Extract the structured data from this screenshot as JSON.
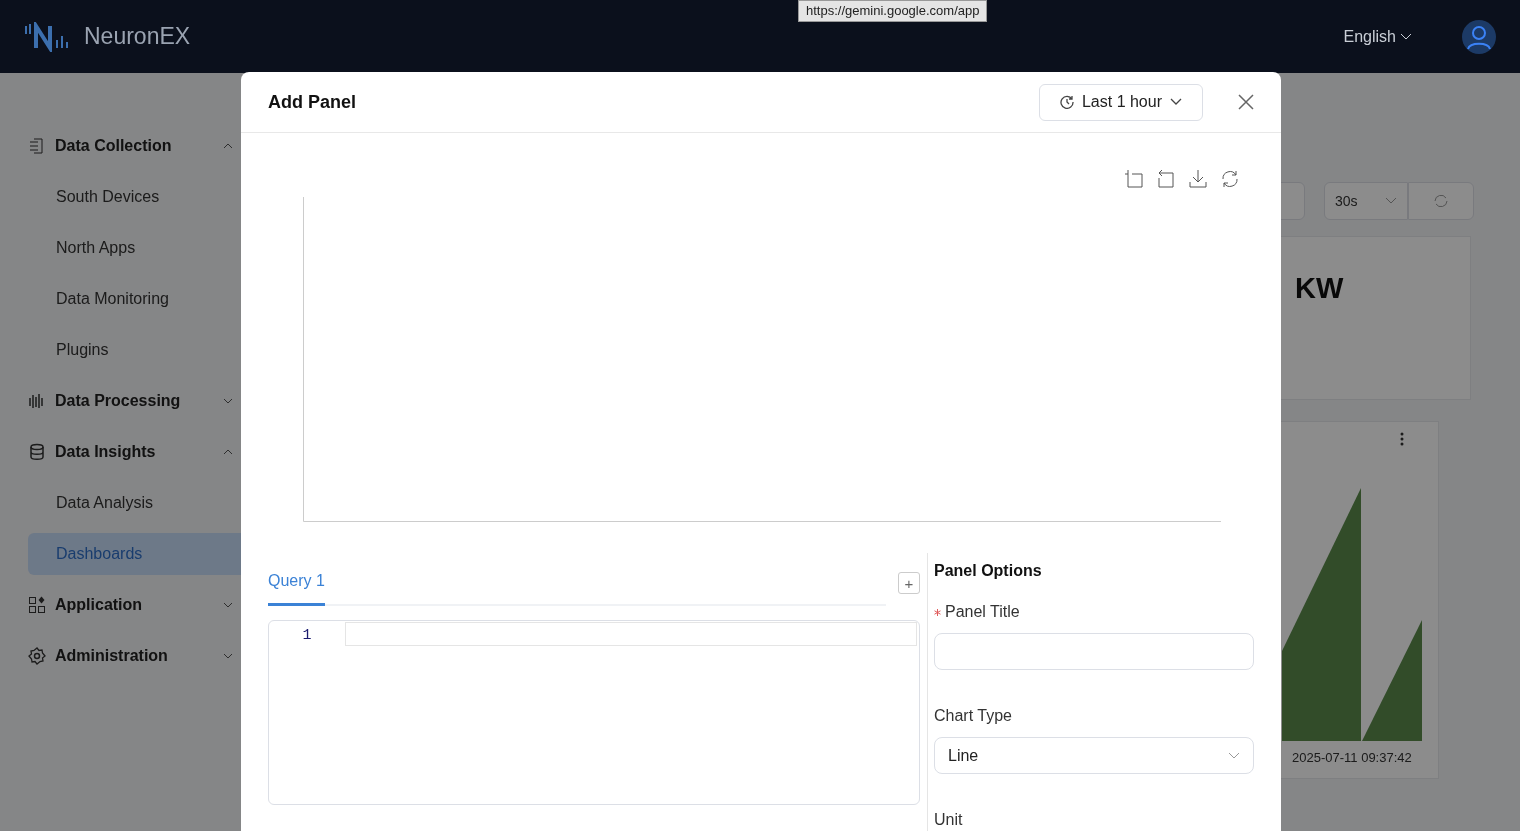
{
  "header": {
    "logo_text": "NeuronEX",
    "language": "English",
    "url_tooltip": "https://gemini.google.com/app"
  },
  "sidebar": {
    "items": [
      {
        "label": "Data Collection",
        "expanded": true,
        "children": [
          {
            "label": "South Devices",
            "selected": false
          },
          {
            "label": "North Apps",
            "selected": false
          },
          {
            "label": "Data Monitoring",
            "selected": false
          },
          {
            "label": "Plugins",
            "selected": false
          }
        ]
      },
      {
        "label": "Data Processing",
        "expanded": false
      },
      {
        "label": "Data Insights",
        "expanded": true,
        "children": [
          {
            "label": "Data Analysis",
            "selected": false
          },
          {
            "label": "Dashboards",
            "selected": true
          }
        ]
      },
      {
        "label": "Application",
        "expanded": false
      },
      {
        "label": "Administration",
        "expanded": false
      }
    ]
  },
  "background": {
    "refresh_interval": "30s",
    "card_title": "KW",
    "timestamp": "2025-07-11 09:37:42"
  },
  "modal": {
    "title": "Add Panel",
    "time_range": "Last 1 hour",
    "query_tabs": [
      {
        "label": "Query 1",
        "selected": true
      }
    ],
    "add_query_label": "+",
    "editor": {
      "line_numbers": [
        "1"
      ]
    },
    "options": {
      "heading": "Panel Options",
      "fields": [
        {
          "kind": "text",
          "label": "Panel Title",
          "required": true
        },
        {
          "kind": "select",
          "label": "Chart Type",
          "value": "Line",
          "required": false
        },
        {
          "kind": "label",
          "label": "Unit",
          "required": false
        }
      ]
    }
  }
}
